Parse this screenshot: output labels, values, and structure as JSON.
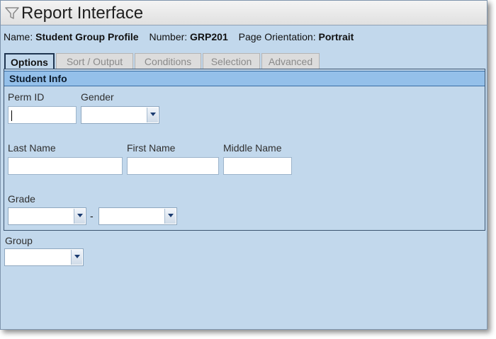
{
  "window": {
    "title": "Report Interface",
    "icon": "filter-icon"
  },
  "info": {
    "name_label": "Name:",
    "name_value": "Student Group Profile",
    "number_label": "Number:",
    "number_value": "GRP201",
    "orientation_label": "Page Orientation:",
    "orientation_value": "Portrait"
  },
  "tabs": [
    {
      "label": "Options",
      "active": true
    },
    {
      "label": "Sort / Output",
      "active": false
    },
    {
      "label": "Conditions",
      "active": false
    },
    {
      "label": "Selection",
      "active": false
    },
    {
      "label": "Advanced",
      "active": false
    }
  ],
  "student_info": {
    "header": "Student Info",
    "perm_id": {
      "label": "Perm ID",
      "value": ""
    },
    "gender": {
      "label": "Gender",
      "value": ""
    },
    "last_name": {
      "label": "Last Name",
      "value": ""
    },
    "first_name": {
      "label": "First Name",
      "value": ""
    },
    "middle_name": {
      "label": "Middle Name",
      "value": ""
    },
    "grade": {
      "label": "Grade",
      "from": "",
      "separator": "-",
      "to": ""
    }
  },
  "group": {
    "label": "Group",
    "value": ""
  },
  "colors": {
    "panel_bg": "#c2d8ec",
    "section_header_bg": "#94c0ea",
    "border": "#3b5470"
  }
}
